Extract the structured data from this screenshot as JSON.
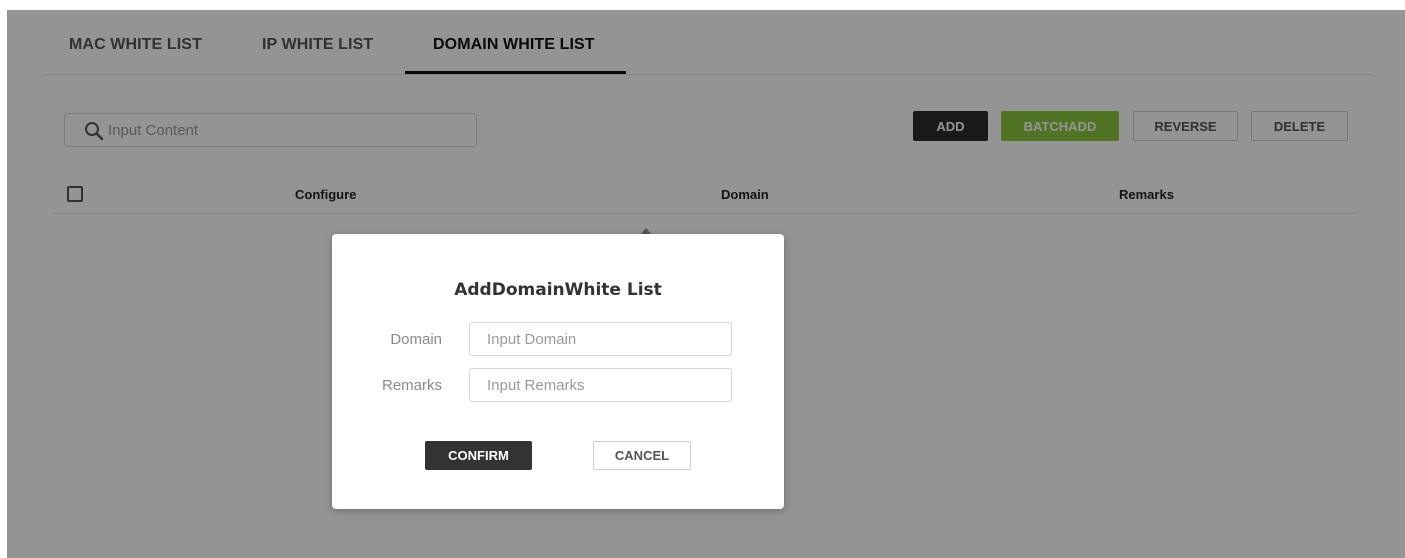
{
  "tabs": [
    {
      "label": "MAC WHITE LIST"
    },
    {
      "label": "IP WHITE LIST"
    },
    {
      "label": "DOMAIN WHITE LIST",
      "active": true
    }
  ],
  "search": {
    "placeholder": "Input Content",
    "icon": "search-icon"
  },
  "toolbar": {
    "add_label": "ADD",
    "batchadd_label": "BATCHADD",
    "reverse_label": "REVERSE",
    "delete_label": "DELETE"
  },
  "table": {
    "columns": [
      "Configure",
      "Domain",
      "Remarks"
    ]
  },
  "modal": {
    "title": "AddDomainWhite List",
    "domain_label": "Domain",
    "domain_placeholder": "Input Domain",
    "remarks_label": "Remarks",
    "remarks_placeholder": "Input Remarks",
    "confirm_label": "CONFIRM",
    "cancel_label": "CANCEL"
  },
  "colors": {
    "accent_green": "#8cc63f",
    "dark_button": "#2b2b2b"
  }
}
